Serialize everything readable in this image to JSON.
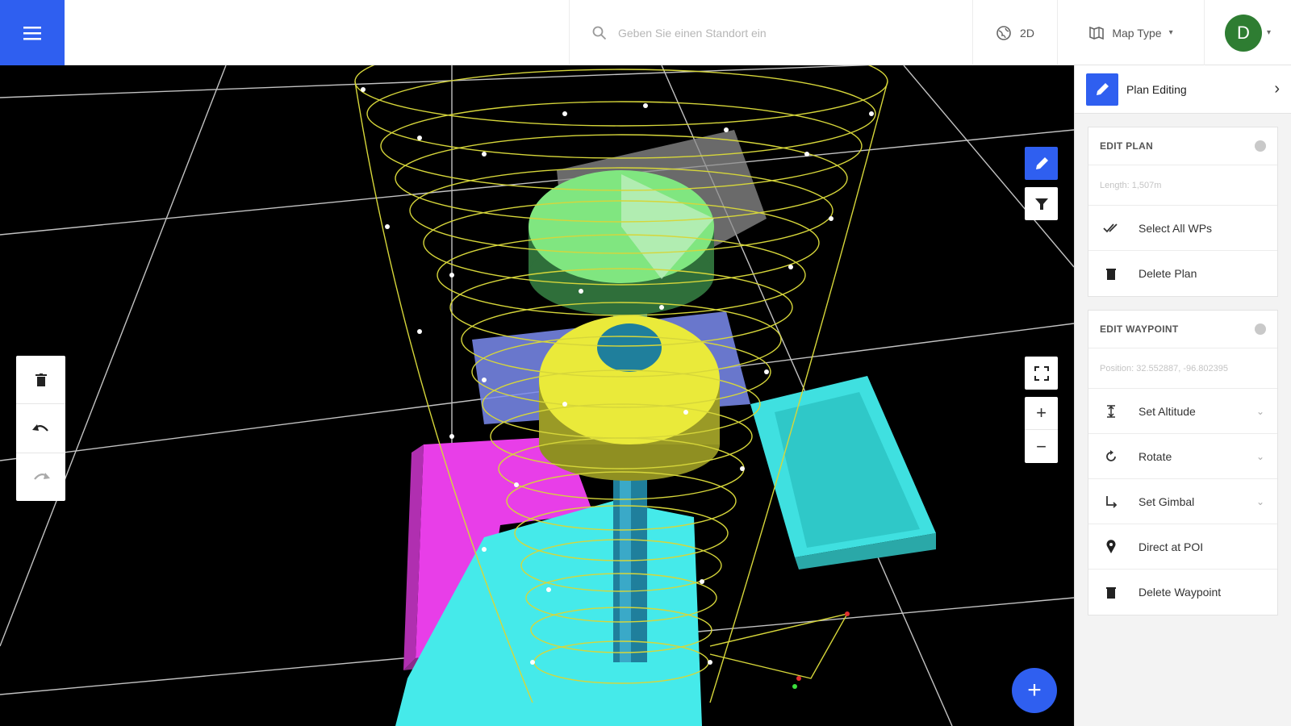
{
  "topbar": {
    "menu_icon": "hamburger-icon",
    "search": {
      "placeholder": "Geben Sie einen Standort ein",
      "value": "",
      "icon": "search-icon"
    },
    "view_toggle": {
      "label": "2D",
      "icon": "globe-icon"
    },
    "map_type": {
      "label": "Map Type",
      "icon": "map-icon"
    },
    "user": {
      "initial": "D",
      "avatar_color": "#2e7d32"
    }
  },
  "map": {
    "left_tools": [
      {
        "name": "delete",
        "icon": "trash-icon"
      },
      {
        "name": "undo",
        "icon": "undo-icon"
      },
      {
        "name": "redo",
        "icon": "redo-icon"
      }
    ],
    "controls": {
      "edit_mode_icon": "pencil-icon",
      "filter_icon": "filter-icon",
      "fullscreen_icon": "fullscreen-icon",
      "zoom_in": "+",
      "zoom_out": "−"
    },
    "fab": "+"
  },
  "panel": {
    "title": "Plan Editing",
    "edit_plan": {
      "header": "EDIT PLAN",
      "info": "Length: 1,507m",
      "actions": [
        {
          "label": "Select All WPs",
          "icon": "double-check-icon"
        },
        {
          "label": "Delete Plan",
          "icon": "trash-icon"
        }
      ]
    },
    "edit_waypoint": {
      "header": "EDIT WAYPOINT",
      "info": "Position: 32.552887, -96.802395",
      "actions": [
        {
          "label": "Set Altitude",
          "icon": "altitude-icon",
          "expandable": true
        },
        {
          "label": "Rotate",
          "icon": "rotate-icon",
          "expandable": true
        },
        {
          "label": "Set Gimbal",
          "icon": "gimbal-icon",
          "expandable": true
        },
        {
          "label": "Direct at POI",
          "icon": "pin-icon",
          "expandable": false
        },
        {
          "label": "Delete Waypoint",
          "icon": "trash-icon",
          "expandable": false
        }
      ]
    }
  },
  "colors": {
    "accent": "#2f5ff0",
    "path": "#d6d63a",
    "magenta": "#e83ee8",
    "cyan": "#3fe7e7",
    "green": "#7ee07e",
    "yellow": "#e8e83a"
  }
}
